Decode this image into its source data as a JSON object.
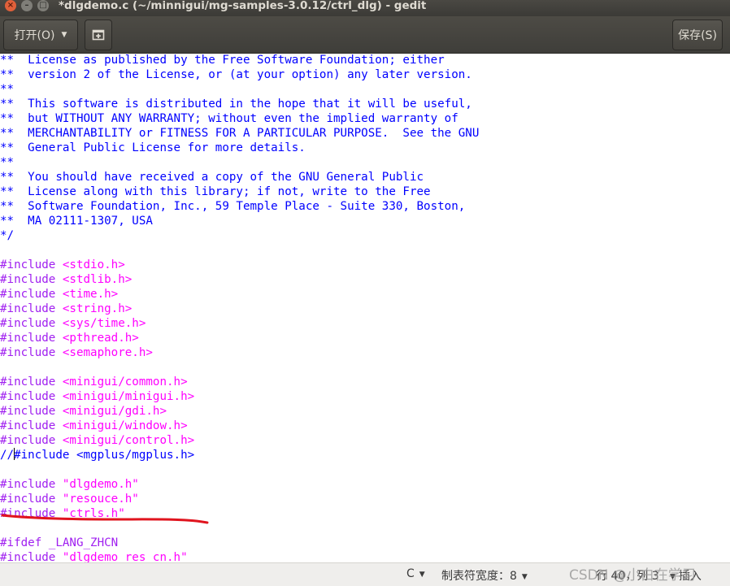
{
  "window": {
    "title": "*dlgdemo.c (~/minnigui/mg-samples-3.0.12/ctrl_dlg) - gedit",
    "close_glyph": "×",
    "min_glyph": "–",
    "max_glyph": "□"
  },
  "toolbar": {
    "open_label": "打开(O)",
    "open_arrow": "▼",
    "save_label": "保存(S)"
  },
  "editor": {
    "lines": [
      {
        "t": "comment",
        "s": "**  License as published by the Free Software Foundation; either"
      },
      {
        "t": "comment",
        "s": "**  version 2 of the License, or (at your option) any later version."
      },
      {
        "t": "comment",
        "s": "**"
      },
      {
        "t": "comment",
        "s": "**  This software is distributed in the hope that it will be useful,"
      },
      {
        "t": "comment",
        "s": "**  but WITHOUT ANY WARRANTY; without even the implied warranty of"
      },
      {
        "t": "comment",
        "s": "**  MERCHANTABILITY or FITNESS FOR A PARTICULAR PURPOSE.  See the GNU"
      },
      {
        "t": "comment",
        "s": "**  General Public License for more details."
      },
      {
        "t": "comment",
        "s": "**"
      },
      {
        "t": "comment",
        "s": "**  You should have received a copy of the GNU General Public"
      },
      {
        "t": "comment",
        "s": "**  License along with this library; if not, write to the Free"
      },
      {
        "t": "comment",
        "s": "**  Software Foundation, Inc., 59 Temple Place - Suite 330, Boston,"
      },
      {
        "t": "comment",
        "s": "**  MA 02111-1307, USA"
      },
      {
        "t": "comment",
        "s": "*/"
      },
      {
        "t": "blank",
        "s": ""
      },
      {
        "t": "include",
        "d": "#include",
        "a": " <stdio.h>"
      },
      {
        "t": "include",
        "d": "#include",
        "a": " <stdlib.h>"
      },
      {
        "t": "include",
        "d": "#include",
        "a": " <time.h>"
      },
      {
        "t": "include",
        "d": "#include",
        "a": " <string.h>"
      },
      {
        "t": "include",
        "d": "#include",
        "a": " <sys/time.h>"
      },
      {
        "t": "include",
        "d": "#include",
        "a": " <pthread.h>"
      },
      {
        "t": "include",
        "d": "#include",
        "a": " <semaphore.h>"
      },
      {
        "t": "blank",
        "s": ""
      },
      {
        "t": "include",
        "d": "#include",
        "a": " <minigui/common.h>"
      },
      {
        "t": "include",
        "d": "#include",
        "a": " <minigui/minigui.h>"
      },
      {
        "t": "include",
        "d": "#include",
        "a": " <minigui/gdi.h>"
      },
      {
        "t": "include",
        "d": "#include",
        "a": " <minigui/window.h>"
      },
      {
        "t": "include",
        "d": "#include",
        "a": " <minigui/control.h>"
      },
      {
        "t": "cursor_comment",
        "p": "//",
        "s": "#include <mgplus/mgplus.h>"
      },
      {
        "t": "blank",
        "s": ""
      },
      {
        "t": "include",
        "d": "#include",
        "a": " \"dlgdemo.h\""
      },
      {
        "t": "include",
        "d": "#include",
        "a": " \"resouce.h\""
      },
      {
        "t": "include",
        "d": "#include",
        "a": " \"ctrls.h\""
      },
      {
        "t": "blank",
        "s": ""
      },
      {
        "t": "pre_plain",
        "d": "#ifdef",
        "a": " _LANG_ZHCN"
      },
      {
        "t": "include",
        "d": "#include",
        "a": " \"dlgdemo_res_cn.h\""
      }
    ]
  },
  "statusbar": {
    "language": "C",
    "tab_width_label": "制表符宽度：8",
    "position": "行 40，列 3",
    "mode": "插入",
    "dropdown_arrow": "▼",
    "watermark": "CSDN @小白在学习"
  },
  "colors": {
    "comment": "#0000ff",
    "preprocessor": "#a020f0",
    "include_arg": "#ff00ff",
    "annotation": "#e0141e"
  }
}
